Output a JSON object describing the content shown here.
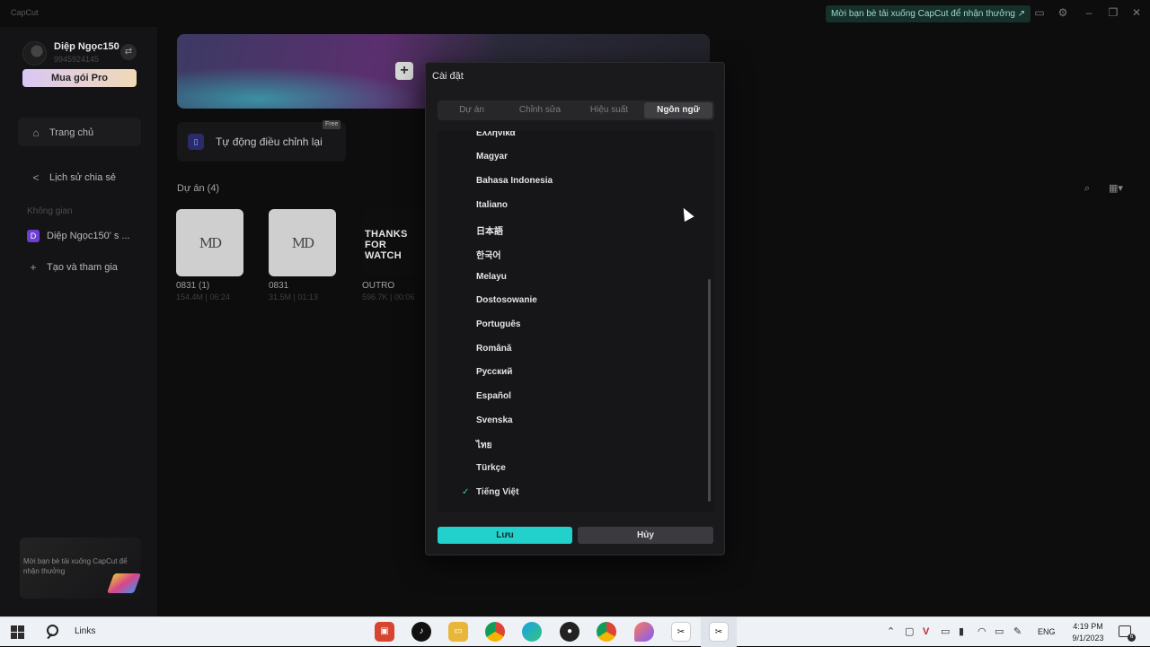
{
  "app": {
    "name": "CapCut"
  },
  "topbar": {
    "invite": "Mời bạn bè tải xuống CapCut để nhận thưởng ↗"
  },
  "user": {
    "name": "Diệp Ngọc150",
    "id": "9945924145",
    "pro_button": "Mua gói Pro"
  },
  "sidebar": {
    "home": "Trang chủ",
    "share_history": "Lịch sử chia sẻ",
    "workspace_label": "Không gian",
    "workspace_badge": "D",
    "workspace_name": "Diệp Ngọc150' s ...",
    "create_join": "Tạo và tham gia",
    "promo": "Mời bạn bè tải xuống CapCut để nhận thưởng"
  },
  "main": {
    "auto_adjust": "Tự động điều chỉnh lại",
    "free_badge": "Free",
    "projects_header": "Dự án (4)",
    "projects": [
      {
        "name": "0831 (1)",
        "meta": "154.4M | 06:24"
      },
      {
        "name": "0831",
        "meta": "31.5M | 01:13"
      },
      {
        "name": "OUTRO",
        "meta": "596.7K | 00:06",
        "thumb_text": "THANKS FOR WATCH"
      }
    ],
    "thumb_logo": "MD"
  },
  "dialog": {
    "title": "Cài đặt",
    "tabs": [
      "Dự án",
      "Chỉnh sửa",
      "Hiệu suất",
      "Ngôn ngữ"
    ],
    "active_tab": "Ngôn ngữ",
    "languages": [
      "Ελληνικά",
      "Magyar",
      "Bahasa Indonesia",
      "Italiano",
      "日本語",
      "한국어",
      "Melayu",
      "Dostosowanie",
      "Português",
      "Română",
      "Русский",
      "Español",
      "Svenska",
      "ไทย",
      "Türkçe",
      "Tiếng Việt"
    ],
    "selected_language": "Tiếng Việt",
    "save": "Lưu",
    "cancel": "Hủy"
  },
  "taskbar": {
    "links": "Links",
    "language": "ENG",
    "time": "4:19 PM",
    "date": "9/1/2023",
    "notification_count": "6"
  },
  "colors": {
    "accent": "#22d0cc",
    "background": "#0d0d0e",
    "dialog": "#1a1a1c"
  }
}
